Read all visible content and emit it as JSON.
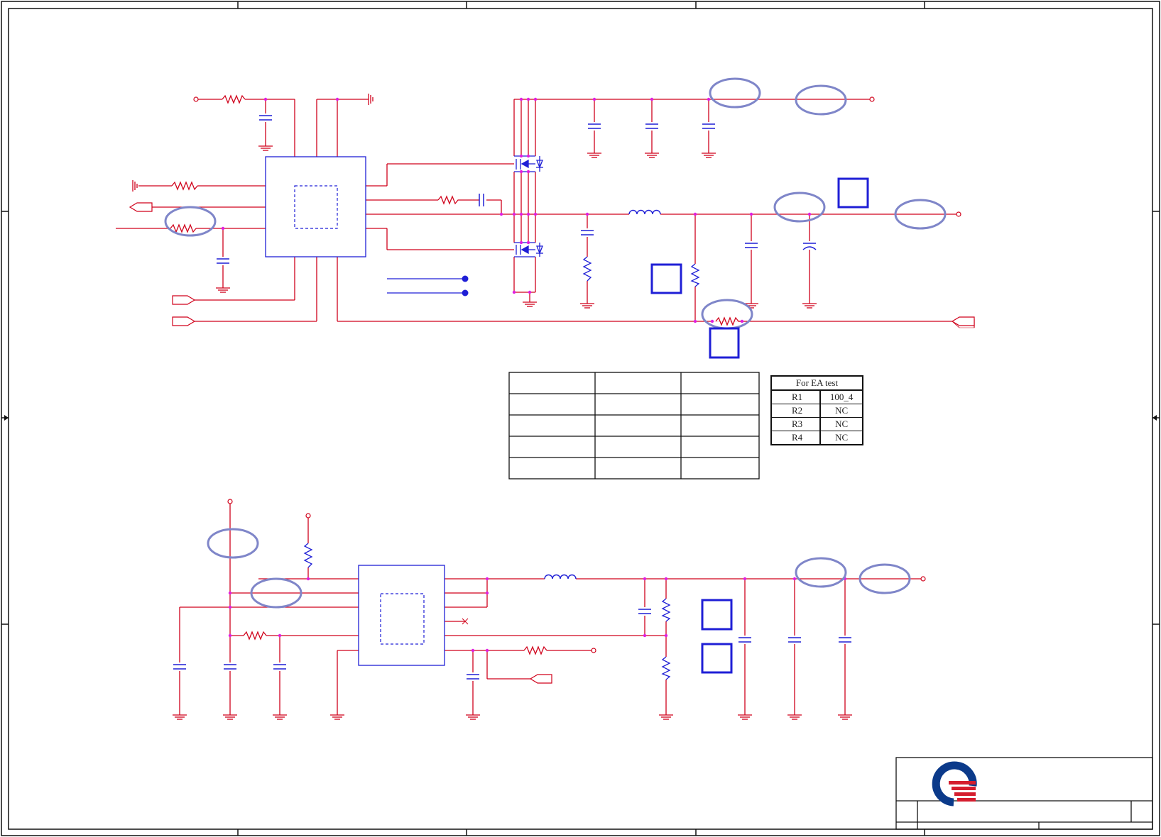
{
  "ea_table": {
    "title": "For EA test",
    "rows": [
      {
        "ref": "R1",
        "value": "100_4"
      },
      {
        "ref": "R2",
        "value": "NC"
      },
      {
        "ref": "R3",
        "value": "NC"
      },
      {
        "ref": "R4",
        "value": "NC"
      }
    ]
  },
  "colors": {
    "wire": "#d0021b",
    "junction": "#e01fe0",
    "component": "#1f1fd6",
    "ellipse": "#7f86c9",
    "frame": "#111111",
    "logo_blue": "#0b3a8a",
    "logo_red": "#d51d2e"
  },
  "logo": {
    "icon": "company-logo-icon"
  }
}
